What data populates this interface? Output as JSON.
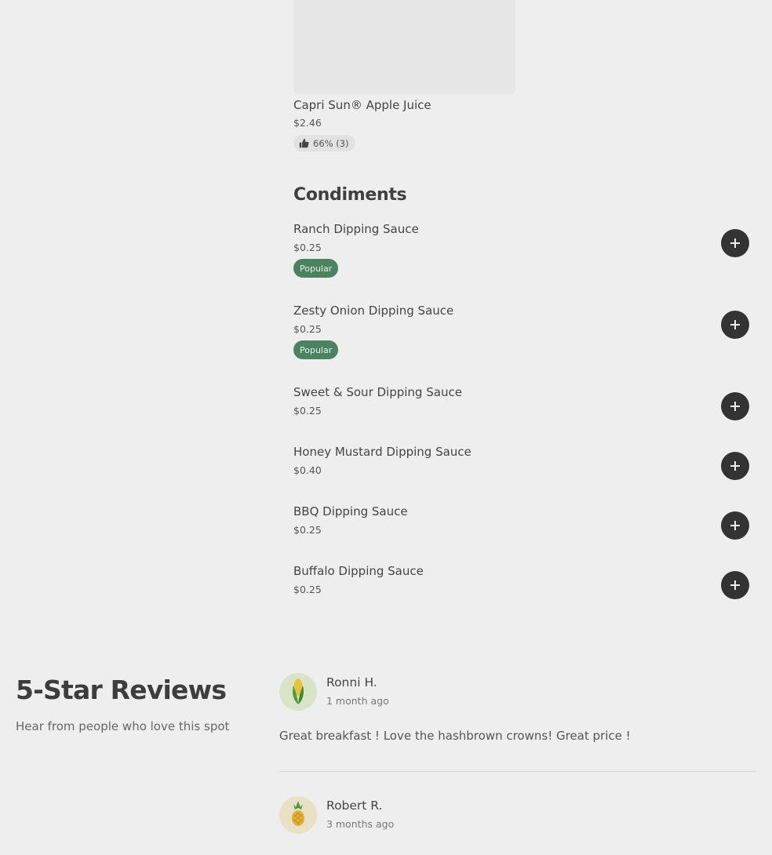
{
  "product": {
    "name": "Capri Sun® Apple Juice",
    "price": "$2.46",
    "rating": "66% (3)",
    "rating_icon": "thumbs-up-icon"
  },
  "condiments": {
    "title": "Condiments",
    "items": [
      {
        "name": "Ranch Dipping Sauce",
        "price": "$0.25",
        "badge": "Popular"
      },
      {
        "name": "Zesty Onion Dipping Sauce",
        "price": "$0.25",
        "badge": "Popular"
      },
      {
        "name": "Sweet & Sour Dipping Sauce",
        "price": "$0.25"
      },
      {
        "name": "Honey Mustard Dipping Sauce",
        "price": "$0.40"
      },
      {
        "name": "BBQ Dipping Sauce",
        "price": "$0.25"
      },
      {
        "name": "Buffalo Dipping Sauce",
        "price": "$0.25"
      }
    ],
    "add_icon": "plus-icon"
  },
  "reviews": {
    "title": "5-Star Reviews",
    "subtitle": "Hear from people who love this spot",
    "items": [
      {
        "name": "Ronni H.",
        "time": "1 month ago",
        "text": "Great breakfast ! Love the hashbrown crowns! Great price !",
        "avatar_icon": "corn-icon"
      },
      {
        "name": "Robert R.",
        "time": "3 months ago",
        "avatar_icon": "pineapple-icon"
      }
    ]
  },
  "colors": {
    "background": "#eeeeee",
    "badge": "#4a8262",
    "add_button": "#333333"
  }
}
